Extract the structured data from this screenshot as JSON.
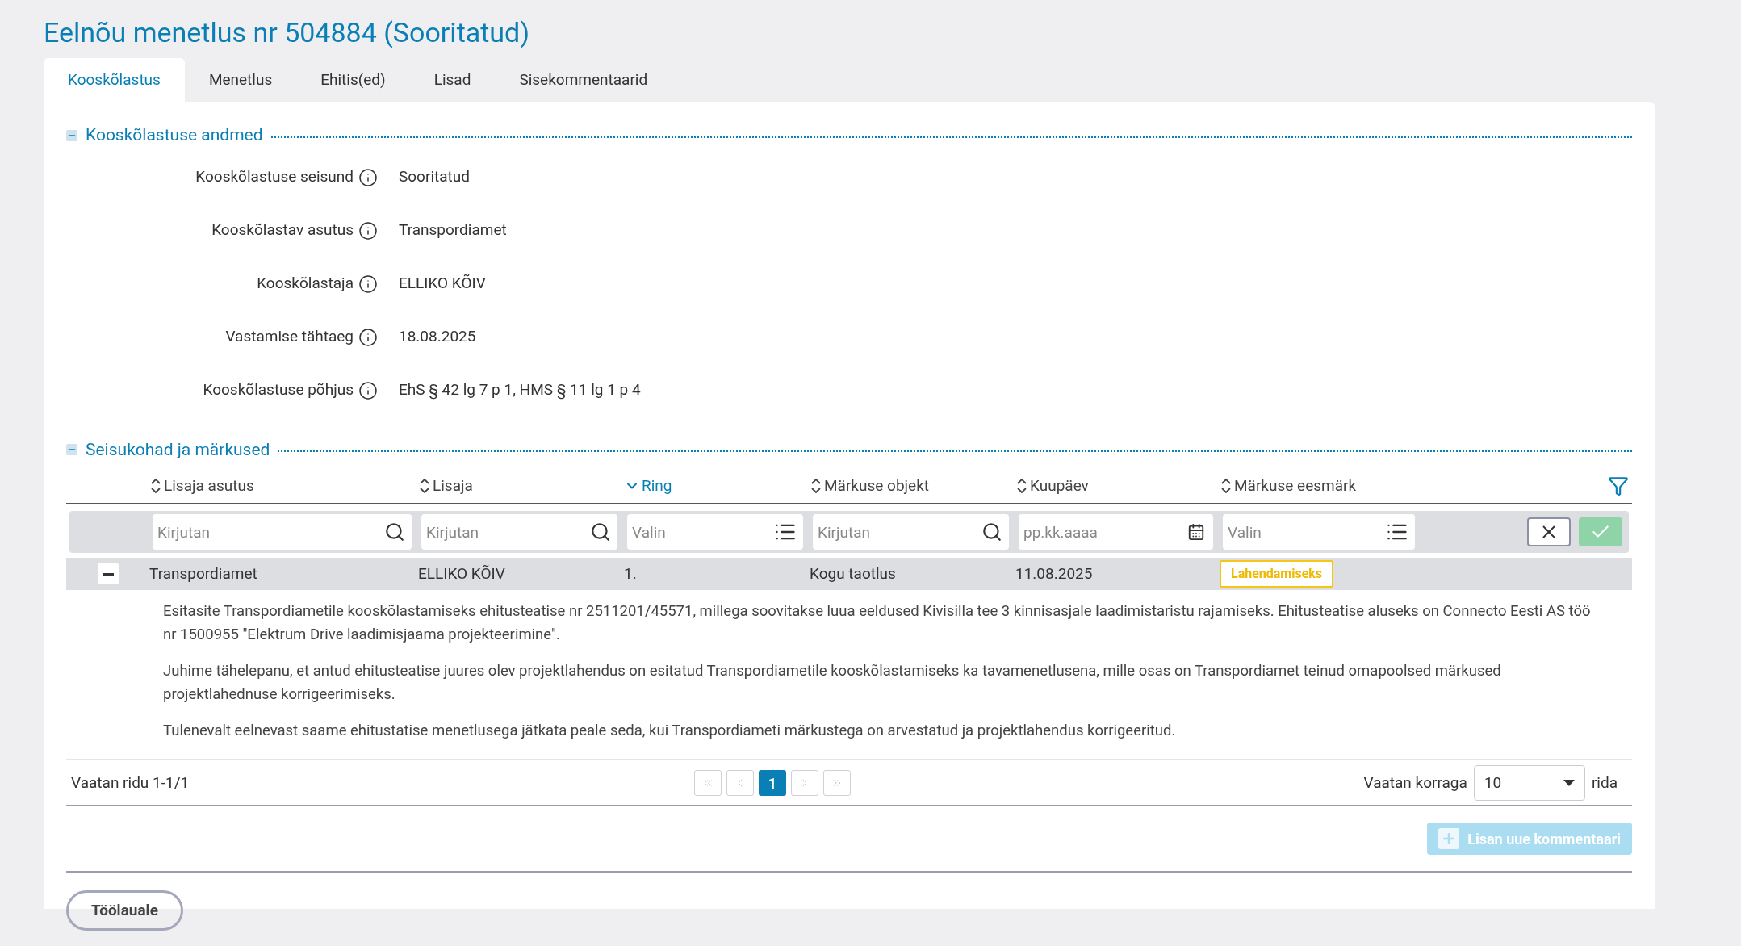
{
  "page_title": "Eelnõu menetlus nr 504884 (Sooritatud)",
  "tabs": [
    {
      "label": "Kooskõlastus",
      "selected": true
    },
    {
      "label": "Menetlus",
      "selected": false
    },
    {
      "label": "Ehitis(ed)",
      "selected": false
    },
    {
      "label": "Lisad",
      "selected": false
    },
    {
      "label": "Sisekommentaarid",
      "selected": false
    }
  ],
  "details_section": {
    "title": "Kooskõlastuse andmed",
    "expanded": true,
    "fields": [
      {
        "label": "Kooskõlastuse seisund",
        "value": "Sooritatud"
      },
      {
        "label": "Kooskõlastav asutus",
        "value": "Transpordiamet"
      },
      {
        "label": "Kooskõlastaja",
        "value": "ELLIKO KÕIV"
      },
      {
        "label": "Vastamise tähtaeg",
        "value": "18.08.2025"
      },
      {
        "label": "Kooskõlastuse põhjus",
        "value": "EhS § 42 lg 7 p 1, HMS § 11 lg 1 p 4"
      }
    ]
  },
  "comments_section": {
    "title": "Seisukohad ja märkused",
    "expanded": true,
    "columns": [
      {
        "label": "Lisaja asutus",
        "sorted": false
      },
      {
        "label": "Lisaja",
        "sorted": false
      },
      {
        "label": "Ring",
        "sorted": true
      },
      {
        "label": "Märkuse objekt",
        "sorted": false
      },
      {
        "label": "Kuupäev",
        "sorted": false
      },
      {
        "label": "Märkuse eesmärk",
        "sorted": false
      }
    ],
    "filters": [
      {
        "kind": "text",
        "placeholder": "Kirjutan"
      },
      {
        "kind": "text",
        "placeholder": "Kirjutan"
      },
      {
        "kind": "select",
        "placeholder": "Valin"
      },
      {
        "kind": "text",
        "placeholder": "Kirjutan"
      },
      {
        "kind": "date",
        "placeholder": "pp.kk.aaaa"
      },
      {
        "kind": "select",
        "placeholder": "Valin"
      }
    ],
    "rows": [
      {
        "expanded": true,
        "cells": [
          "Transpordiamet",
          "ELLIKO KÕIV",
          "1.",
          "Kogu taotlus",
          "11.08.2025"
        ],
        "purpose": "Lahendamiseks",
        "paragraphs": [
          "Esitasite Transpordiametile kooskõlastamiseks ehitusteatise nr 2511201/45571, millega soovitakse luua eeldused Kivisilla tee 3 kinnisasjale laadimistaristu rajamiseks. Ehitusteatise aluseks on Connecto Eesti AS töö nr 1500955 \"Elektrum Drive laadimisjaama projekteerimine\".",
          "Juhime tähelepanu, et antud ehitusteatise juures olev projektlahendus on esitatud Transpordiametile kooskõlastamiseks ka tavamenetlusena, mille osas on Transpordiamet teinud omapoolsed märkused projektlahednuse korrigeerimiseks.",
          "Tulenevalt eelnevast saame ehitustatise menetlusega jätkata peale seda, kui Transpordiameti märkustega on arvestatud ja projektlahendus korrigeeritud."
        ]
      }
    ],
    "footer": {
      "range": "Vaatan ridu 1-1/1",
      "nav_before": [
        {
          "kind": "first",
          "disabled": true
        },
        {
          "kind": "prev",
          "disabled": true
        }
      ],
      "pages": [
        {
          "label": "1",
          "selected": true
        }
      ],
      "nav_after": [
        {
          "kind": "next",
          "disabled": true
        },
        {
          "kind": "last",
          "disabled": true
        }
      ],
      "page_size_label": "Vaatan korraga",
      "page_size": "10",
      "page_size_unit": "rida"
    },
    "add_button": {
      "label": "Lisan uue kommentaari",
      "disabled": true
    }
  },
  "back_button": {
    "label": "Töölauale"
  }
}
